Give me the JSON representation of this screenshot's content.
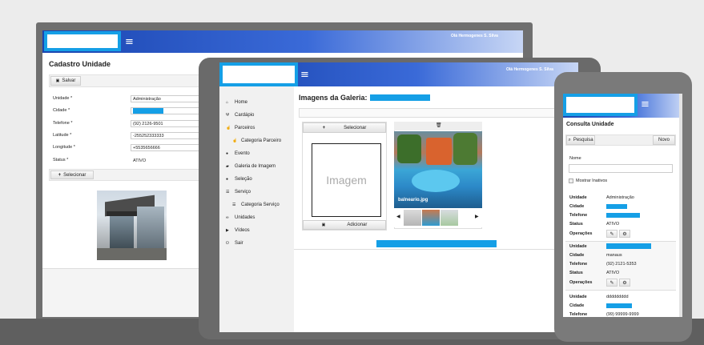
{
  "greeting": "Olá Hermogenes S. Silva",
  "laptop": {
    "title": "Cadastro Unidade",
    "save_label": "Salvar",
    "fields": [
      {
        "label": "Unidade *",
        "value": "Administração"
      },
      {
        "label": "Cidade *",
        "value": ""
      },
      {
        "label": "Telefone *",
        "value": "(92) 2126-9501"
      },
      {
        "label": "Latitude *",
        "value": "-255252333333"
      },
      {
        "label": "Longitude *",
        "value": "+5535656666"
      },
      {
        "label": "Status *",
        "value": "ATIVO"
      }
    ],
    "select_label": "Selecionar"
  },
  "tablet": {
    "title": "Imagens da Galeria:",
    "nav": [
      {
        "label": "Home",
        "icon": "home-icon",
        "glyph": "⌂"
      },
      {
        "label": "Cardápio",
        "icon": "cutlery-icon",
        "glyph": "Ψ"
      },
      {
        "label": "Parceiros",
        "icon": "thumbs-up-icon",
        "glyph": "☝"
      },
      {
        "label": "Categoria Parceiro",
        "icon": "thumbs-up-icon",
        "glyph": "☝",
        "sub": true
      },
      {
        "label": "Evento",
        "icon": "user-icon",
        "glyph": "●"
      },
      {
        "label": "Galeria de Imagem",
        "icon": "folder-icon",
        "glyph": "▰"
      },
      {
        "label": "Seleção",
        "icon": "users-icon",
        "glyph": "●"
      },
      {
        "label": "Serviço",
        "icon": "list-icon",
        "glyph": "☰"
      },
      {
        "label": "Categoria Serviço",
        "icon": "list-icon",
        "glyph": "☰",
        "sub": true
      },
      {
        "label": "Unidades",
        "icon": "link-icon",
        "glyph": "∞"
      },
      {
        "label": "Vídeos",
        "icon": "video-icon",
        "glyph": "▶"
      },
      {
        "label": "Sair",
        "icon": "power-icon",
        "glyph": "⏻"
      }
    ],
    "select_label": "Selecionar",
    "placeholder_text": "Imagem",
    "add_label": "Adicionar",
    "photo_caption": "balneario.jpg"
  },
  "phone": {
    "title": "Consulta Unidade",
    "search_label": "Pesquisa",
    "new_label": "Novo",
    "name_label": "Nome",
    "show_inactive_label": "Mostrar Inativos",
    "ops_label": "Operações",
    "records": [
      {
        "unidade": "Administração",
        "cidade": "",
        "telefone": "",
        "status": "ATIVO",
        "ops": true
      },
      {
        "unidade": "",
        "cidade": "manaus",
        "telefone": "(92) 2121-5353",
        "status": "ATIVO",
        "ops": true
      },
      {
        "unidade": "ddddddddd",
        "cidade": "",
        "telefone": "(99) 99999-9999",
        "status": "",
        "ops": false
      }
    ],
    "keys": {
      "unidade": "Unidade",
      "cidade": "Cidade",
      "telefone": "Telefone",
      "status": "Status"
    }
  }
}
